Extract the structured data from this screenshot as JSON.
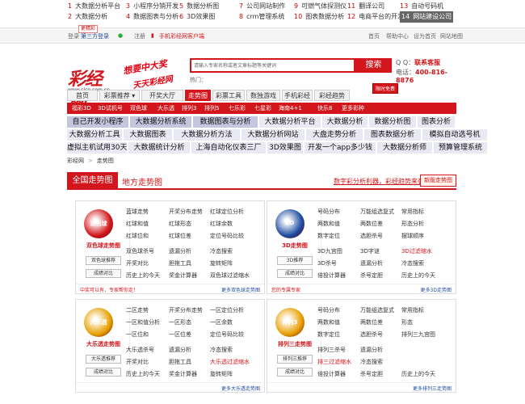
{
  "top_links": [
    {
      "n": "1",
      "label": "大数据分析平台"
    },
    {
      "n": "3",
      "label": "小程序分销开发"
    },
    {
      "n": "5",
      "label": "数据分析图"
    },
    {
      "n": "7",
      "label": "公司网站制作"
    },
    {
      "n": "9",
      "label": "可燃气体探测仪"
    },
    {
      "n": "11",
      "label": "翻译公司"
    },
    {
      "n": "13",
      "label": "自动号码机"
    },
    {
      "n": "2",
      "label": "大数据分析"
    },
    {
      "n": "4",
      "label": "数据图表与分析"
    },
    {
      "n": "6",
      "label": "3D效果图"
    },
    {
      "n": "8",
      "label": "crm管理系统"
    },
    {
      "n": "10",
      "label": "图表数据分析"
    },
    {
      "n": "12",
      "label": "电商平台的开发"
    },
    {
      "n": "14",
      "label": "网站建设公司"
    }
  ],
  "bar": {
    "login": "登录",
    "ghost": "更精彩",
    "third": "第三方登录",
    "register": "注册",
    "mobile": "手机彩经网客户端",
    "home": "首页",
    "help": "帮助中心",
    "set_home": "设为首页",
    "sitemap": "网站地图"
  },
  "logo": {
    "big": "彩经网",
    "url": "www.cjcp.com.cn"
  },
  "slogan": {
    "line1": "想要中大奖",
    "line2": "天天彩经网"
  },
  "search": {
    "placeholder": "请输入专家名称或者文章标题等关键词",
    "button": "搜索",
    "hot": "热门："
  },
  "contact": {
    "qq_label": "Q Q：",
    "qq_value": "联系客服",
    "tel_label": "电话：",
    "tel_value": "400-816-8876"
  },
  "nav": {
    "free_badge": "限时免费",
    "items": [
      "首页",
      "彩票推荐 ▾",
      "开奖大厅",
      "走势图",
      "彩票工具",
      "数独游戏",
      "手机彩经网",
      "彩经趋势"
    ]
  },
  "subnav": [
    "福彩3D",
    "3D试机号",
    "双色球",
    "大乐透",
    "排列3",
    "排列5",
    "七乐彩",
    "七星彩",
    "海南4+1",
    "快乐8",
    "更多彩种"
  ],
  "keywords": [
    [
      "自己开发小程序",
      "大数据分析系统",
      "数据图表与分析",
      "大数据分析平台",
      "大数据分析",
      "数据分析图",
      "图表分析"
    ],
    [
      "大数据分析工具",
      "大数据图表",
      "大数据分析方法",
      "大数据分析网站",
      "大盘走势分析",
      "图表数据分析",
      "模拟自动选号机"
    ],
    [
      "虚拟主机试用30天",
      "大数据统计分析",
      "上海自动化仪表三厂",
      "3D效果图",
      "开发一个app多少钱",
      "大数据分析师",
      "预算管理系统"
    ]
  ],
  "crumb": {
    "home": "彩经网",
    "sep": ">",
    "current": "走势图"
  },
  "tabs": {
    "active": "全国走势图",
    "other": "地方走势图",
    "promo": "数字彩分析利器，彩经趋势来袭",
    "new_version": "新版走势图"
  },
  "panels": [
    {
      "name": "双色球走势图",
      "icon_text": "双色球",
      "buttons": [
        "双色球推荐",
        "成绩对比"
      ],
      "cols": [
        [
          "蓝球走势",
          "红球和值",
          "红球位和",
          "双色球杀号",
          "开奖对比",
          "历史上的今天"
        ],
        [
          "开奖分布走势",
          "红球形态",
          "红球位差",
          "遗漏分析",
          "胆拖工具",
          "奖金计算器"
        ],
        [
          "红球定位分析",
          "红球余数",
          "定位号码比较",
          "冷态搜索",
          "旋转矩阵",
          "双色球过滤缩水"
        ]
      ],
      "red_items": [],
      "foot_left": "中奖可以有，专家帮你走！",
      "foot_right": "更多双色球走势图"
    },
    {
      "name": "3D走势图",
      "icon_text": "3D",
      "buttons": [
        "3D推荐",
        "成绩对比"
      ],
      "cols": [
        [
          "号码分布",
          "两数和值",
          "数字定位",
          "3D九宫图",
          "3D杀号",
          "倍投计算器"
        ],
        [
          "万能组选复式",
          "两数位差",
          "选胆杀号",
          "3D字谜",
          "遗漏分析",
          "杀号定胆"
        ],
        [
          "常用指标",
          "形态分析",
          "摆球顺序",
          "3D过滤缩水",
          "冷态搜索",
          "历史上的今天"
        ]
      ],
      "red_items": [
        "3D过滤缩水"
      ],
      "foot_left": "您的专属专家",
      "foot_right": "更多3D走势图"
    },
    {
      "name": "大乐透走势图",
      "icon_text": "大乐透",
      "buttons": [
        "大乐透推荐",
        "成绩对比"
      ],
      "cols": [
        [
          "二区走势",
          "一区和值分析",
          "一区位和",
          "大乐透杀号",
          "开奖对比",
          "历史上的今天"
        ],
        [
          "开奖分布走势",
          "一区形态",
          "一区位差",
          "遗漏分析",
          "胆拖工具",
          "奖金计算器"
        ],
        [
          "一区定位分析",
          "一区余数",
          "定位号码比较",
          "冷态搜索",
          "大乐透过滤缩水",
          "旋转矩阵"
        ]
      ],
      "red_items": [
        "大乐透过滤缩水"
      ],
      "foot_left": "",
      "foot_right": "更多大乐透走势图"
    },
    {
      "name": "排列三走势图",
      "icon_text": "排列3",
      "buttons": [
        "排列三推荐",
        "成绩对比"
      ],
      "cols": [
        [
          "号码分布",
          "两数和值",
          "数字定位",
          "排列三杀号",
          "排三过滤缩水",
          "倍投计算器"
        ],
        [
          "万能组选复式",
          "两数位差",
          "选胆杀号",
          "遗漏分析",
          "冷态搜索",
          "杀号定胆"
        ],
        [
          "常用指标",
          "形态",
          "排列三九宫图",
          "",
          "",
          "历史上的今天"
        ]
      ],
      "red_items": [
        "排三过滤缩水"
      ],
      "foot_left": "",
      "foot_right": "更多排列三走势图"
    }
  ],
  "colors": {
    "brand_red": "#d3161b",
    "link_blue": "#1d4ba0",
    "kw_bg": "#e9e9f3"
  }
}
